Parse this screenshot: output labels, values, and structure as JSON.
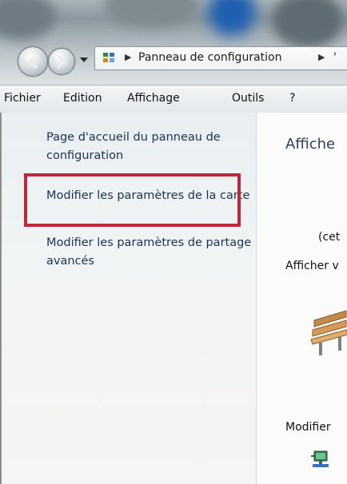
{
  "address_bar": {
    "crumb": "Panneau de configuration",
    "crumb_next": "'"
  },
  "menu": {
    "items": [
      "Fichier",
      "Edition",
      "Affichage",
      "Outils",
      "?"
    ]
  },
  "left_pane": {
    "links": [
      "Page d'accueil du panneau de configuration",
      "Modifier les paramètres de la carte",
      "Modifier les paramètres de partage avancés"
    ]
  },
  "right_pane": {
    "heading": "Affiche",
    "paren_text": "(cet",
    "view_text": "Afficher v",
    "modify_text": "Modifier"
  },
  "colors": {
    "highlight_border": "#c1273a",
    "link_text": "#1c3250"
  }
}
